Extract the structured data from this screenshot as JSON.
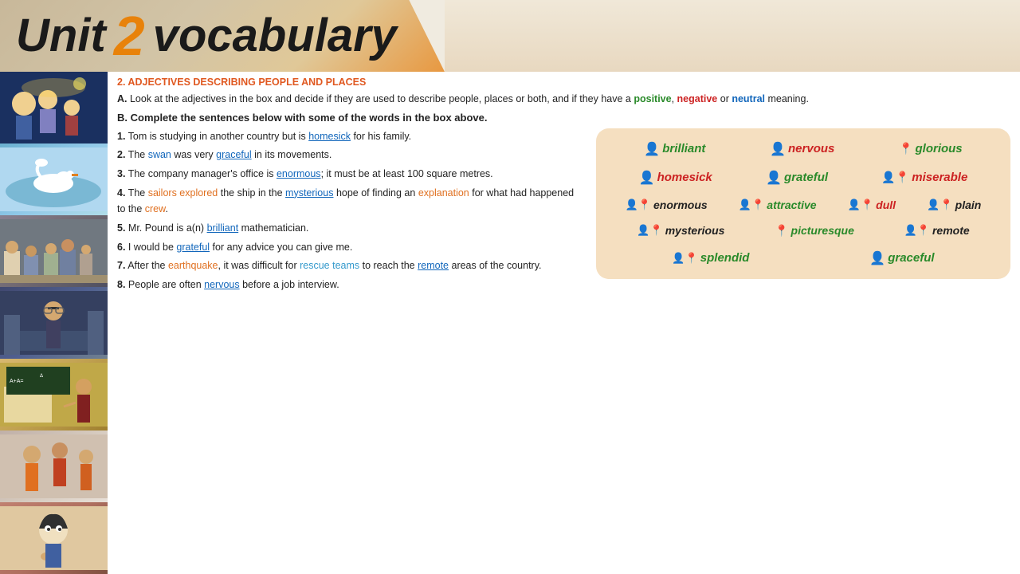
{
  "header": {
    "unit_label": "Unit",
    "unit_number": "2",
    "vocab_label": "vocabulary"
  },
  "section2": {
    "title": "2. ADJECTIVES DESCRIBING PEOPLE AND PLACES",
    "instruction_a_prefix": "A. Look at the adjectives in the box and decide if they are used to describe people, places or both, and if they",
    "instruction_a_suffix": "have a",
    "positive": "positive",
    "negative": "negative",
    "neutral": "neutral",
    "instruction_a_end": "meaning.",
    "instruction_b": "B. Complete the sentences below with some of the words in the box above."
  },
  "sentences": [
    {
      "num": "1.",
      "parts": [
        {
          "text": "Tom is studying in another country but is ",
          "style": "normal"
        },
        {
          "text": "homesick",
          "style": "underline"
        },
        {
          "text": " for his family.",
          "style": "normal"
        }
      ]
    },
    {
      "num": "2.",
      "parts": [
        {
          "text": "The ",
          "style": "normal"
        },
        {
          "text": "swan",
          "style": "highlight-blue"
        },
        {
          "text": " was very ",
          "style": "normal"
        },
        {
          "text": "graceful",
          "style": "underline"
        },
        {
          "text": " in its movements.",
          "style": "normal"
        }
      ]
    },
    {
      "num": "3.",
      "parts": [
        {
          "text": "The company manager's office is ",
          "style": "normal"
        },
        {
          "text": "enormous",
          "style": "underline"
        },
        {
          "text": "; it must be at least 100 square metres.",
          "style": "normal"
        }
      ]
    },
    {
      "num": "4.",
      "parts": [
        {
          "text": "The ",
          "style": "normal"
        },
        {
          "text": "sailors explored",
          "style": "highlight-orange"
        },
        {
          "text": " the ship in the ",
          "style": "normal"
        },
        {
          "text": "mysterious",
          "style": "underline"
        },
        {
          "text": " hope of finding an ",
          "style": "normal"
        },
        {
          "text": "explanation",
          "style": "highlight-orange"
        },
        {
          "text": " for what had happened to the ",
          "style": "normal"
        },
        {
          "text": "crew",
          "style": "highlight-orange"
        },
        {
          "text": ".",
          "style": "normal"
        }
      ]
    },
    {
      "num": "5.",
      "parts": [
        {
          "text": "Mr. Pound is a(n) ",
          "style": "normal"
        },
        {
          "text": "brilliant",
          "style": "underline"
        },
        {
          "text": " mathematician.",
          "style": "normal"
        }
      ]
    },
    {
      "num": "6.",
      "parts": [
        {
          "text": "I would be ",
          "style": "normal"
        },
        {
          "text": "grateful",
          "style": "underline"
        },
        {
          "text": " for any advice you can give me.",
          "style": "normal"
        }
      ]
    },
    {
      "num": "7.",
      "parts": [
        {
          "text": "After the ",
          "style": "normal"
        },
        {
          "text": "earthquake",
          "style": "highlight-orange"
        },
        {
          "text": ", it was difficult for ",
          "style": "normal"
        },
        {
          "text": "rescue teams",
          "style": "highlight-blue"
        },
        {
          "text": " to reach the ",
          "style": "normal"
        },
        {
          "text": "remote",
          "style": "underline"
        },
        {
          "text": " areas of the country.",
          "style": "normal"
        }
      ]
    },
    {
      "num": "8.",
      "parts": [
        {
          "text": "People are often ",
          "style": "normal"
        },
        {
          "text": "nervous",
          "style": "underline"
        },
        {
          "text": " before a job interview.",
          "style": "normal"
        }
      ]
    }
  ],
  "vocab_words": [
    {
      "row": 1,
      "words": [
        {
          "icon": "person",
          "text": "brilliant",
          "color": "green"
        },
        {
          "icon": "person",
          "text": "nervous",
          "color": "red"
        },
        {
          "icon": "place",
          "text": "glorious",
          "color": "green"
        }
      ]
    },
    {
      "row": 2,
      "words": [
        {
          "icon": "person",
          "text": "homesick",
          "color": "red"
        },
        {
          "icon": "person",
          "text": "grateful",
          "color": "green"
        },
        {
          "icon": "both",
          "text": "miserable",
          "color": "red"
        }
      ]
    },
    {
      "row": 3,
      "words": [
        {
          "icon": "both",
          "text": "enormous",
          "color": "normal"
        },
        {
          "icon": "both",
          "text": "attractive",
          "color": "green"
        },
        {
          "icon": "both",
          "text": "dull",
          "color": "red"
        },
        {
          "icon": "both",
          "text": "plain",
          "color": "normal"
        }
      ]
    },
    {
      "row": 4,
      "words": [
        {
          "icon": "both",
          "text": "mysterious",
          "color": "normal"
        },
        {
          "icon": "place",
          "text": "picturesque",
          "color": "green"
        },
        {
          "icon": "both",
          "text": "remote",
          "color": "normal"
        }
      ]
    },
    {
      "row": 5,
      "words": [
        {
          "icon": "both",
          "text": "splendid",
          "color": "green"
        },
        {
          "icon": "person",
          "text": "graceful",
          "color": "green"
        }
      ]
    }
  ],
  "images": [
    "family-scene",
    "swan-image",
    "office-workers",
    "sailors-crew",
    "teacher-math",
    "people-advice",
    "earthquake-rescue"
  ]
}
